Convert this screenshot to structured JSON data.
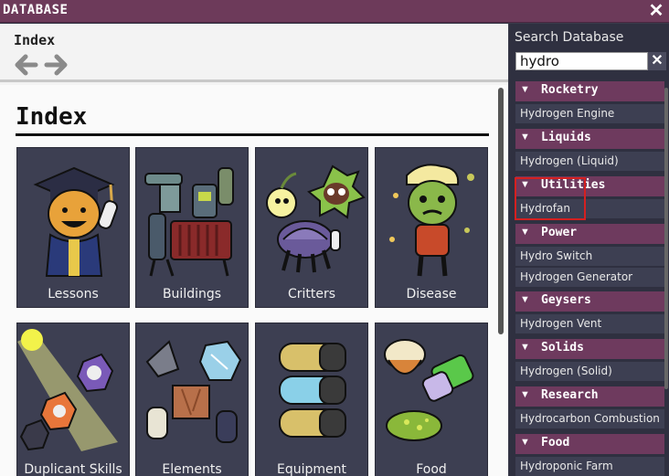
{
  "window": {
    "title": "DATABASE",
    "close_label": "✕"
  },
  "nav": {
    "breadcrumb": "Index"
  },
  "main": {
    "title": "Index",
    "cards": [
      {
        "label": "Lessons",
        "icon": "graduate-icon"
      },
      {
        "label": "Buildings",
        "icon": "machinery-icon"
      },
      {
        "label": "Critters",
        "icon": "critters-icon"
      },
      {
        "label": "Disease",
        "icon": "sick-duplicant-icon"
      },
      {
        "label": "Duplicant Skills",
        "icon": "skills-icon"
      },
      {
        "label": "Elements",
        "icon": "elements-icon"
      },
      {
        "label": "Equipment",
        "icon": "equipment-icon"
      },
      {
        "label": "Food",
        "icon": "food-icon"
      }
    ]
  },
  "sidebar": {
    "search_label": "Search Database",
    "search_value": "hydro",
    "clear_label": "✕",
    "categories": [
      {
        "name": "Rocketry",
        "entries": [
          "Hydrogen Engine"
        ]
      },
      {
        "name": "Liquids",
        "entries": [
          "Hydrogen (Liquid)"
        ]
      },
      {
        "name": "Utilities",
        "entries": [
          "Hydrofan"
        ]
      },
      {
        "name": "Power",
        "entries": [
          "Hydro Switch",
          "Hydrogen Generator"
        ]
      },
      {
        "name": "Geysers",
        "entries": [
          "Hydrogen Vent"
        ]
      },
      {
        "name": "Solids",
        "entries": [
          "Hydrogen (Solid)"
        ]
      },
      {
        "name": "Research",
        "entries": [
          "Hydrocarbon Combustion"
        ]
      },
      {
        "name": "Food",
        "entries": [
          "Hydroponic Farm"
        ]
      }
    ]
  },
  "colors": {
    "titlebar": "#6d3a5a",
    "category_header": "#6e3a5e",
    "card_bg": "#3d3f52",
    "highlight": "#d42020"
  }
}
